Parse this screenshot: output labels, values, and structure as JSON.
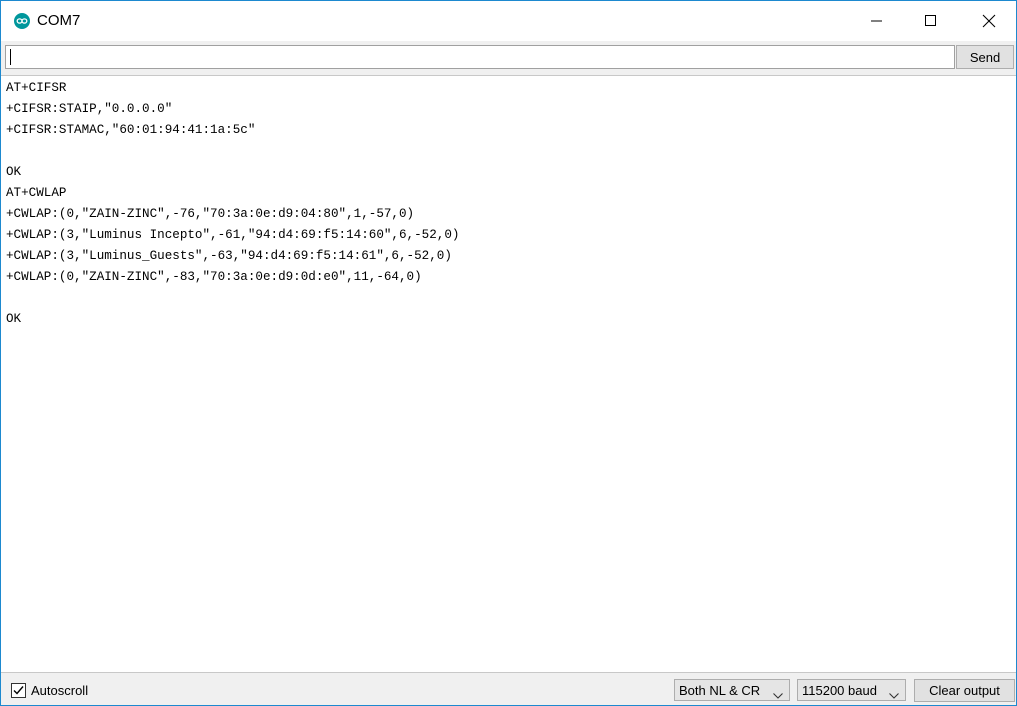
{
  "window": {
    "title": "COM7",
    "icon": "arduino-infinity-icon",
    "controls": [
      "minimize-icon",
      "maximize-icon",
      "close-icon"
    ]
  },
  "input": {
    "value": "",
    "send_label": "Send"
  },
  "output": {
    "lines": [
      "AT+CIFSR",
      "+CIFSR:STAIP,\"0.0.0.0\"",
      "+CIFSR:STAMAC,\"60:01:94:41:1a:5c\"",
      "",
      "OK",
      "AT+CWLAP",
      "+CWLAP:(0,\"ZAIN-ZINC\",-76,\"70:3a:0e:d9:04:80\",1,-57,0)",
      "+CWLAP:(3,\"Luminus Incepto\",-61,\"94:d4:69:f5:14:60\",6,-52,0)",
      "+CWLAP:(3,\"Luminus_Guests\",-63,\"94:d4:69:f5:14:61\",6,-52,0)",
      "+CWLAP:(0,\"ZAIN-ZINC\",-83,\"70:3a:0e:d9:0d:e0\",11,-64,0)",
      "",
      "OK"
    ]
  },
  "statusbar": {
    "autoscroll_label": "Autoscroll",
    "autoscroll_checked": true,
    "line_ending": "Both NL & CR",
    "baud_rate": "115200 baud",
    "clear_label": "Clear output"
  },
  "colors": {
    "accent": "#00979c",
    "window_border": "#1d89cf",
    "toolbar_bg": "#f0f0f0"
  }
}
